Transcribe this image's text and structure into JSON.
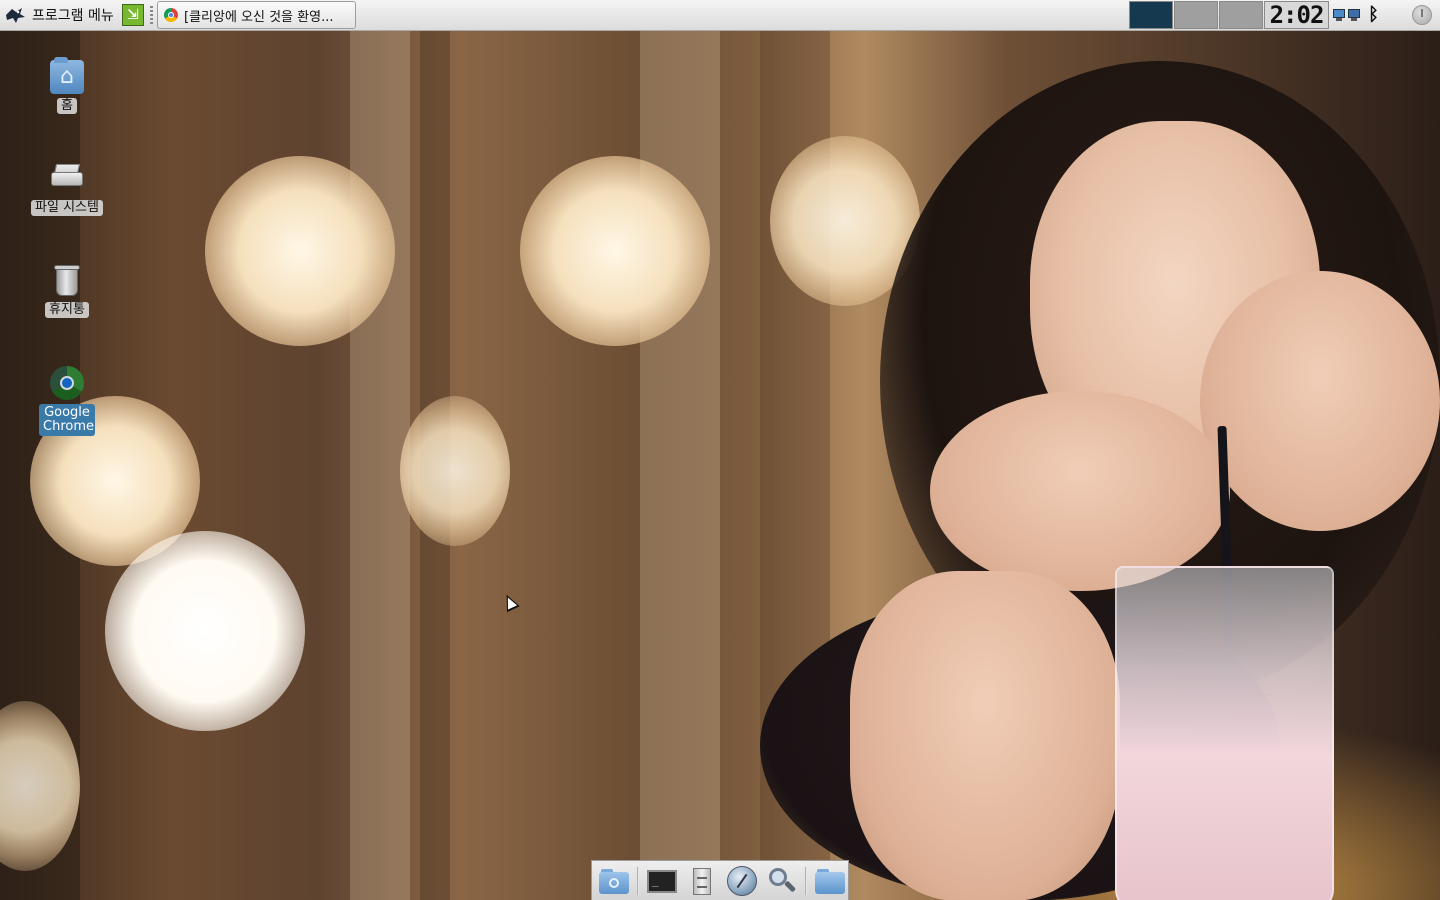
{
  "top_panel": {
    "menu_label": "프로그램 메뉴",
    "task_title": "[클리앙에 오신 것을 환영...",
    "clock": "2:02",
    "icons": [
      "mouse-logo-icon",
      "exit-icon",
      "chrome-icon",
      "network-icon",
      "bluetooth-icon",
      "power-icon"
    ]
  },
  "workspaces": [
    {
      "active": true,
      "color": "#153a4f"
    },
    {
      "active": false,
      "color": "#9f9f9f"
    },
    {
      "active": false,
      "color": "#9f9f9f"
    }
  ],
  "desktop": {
    "icons": [
      {
        "label": "홈",
        "icon": "home-folder-icon"
      },
      {
        "label": "파일 시스템",
        "icon": "drive-icon"
      },
      {
        "label": "휴지통",
        "icon": "trash-icon"
      },
      {
        "label": "Google Chrome",
        "icon": "google-chrome-icon",
        "selected": true
      }
    ]
  },
  "dock": {
    "items": [
      "folder-search-icon",
      "terminal-icon",
      "file-cabinet-icon",
      "web-browser-icon",
      "search-icon",
      "folder-icon"
    ]
  }
}
